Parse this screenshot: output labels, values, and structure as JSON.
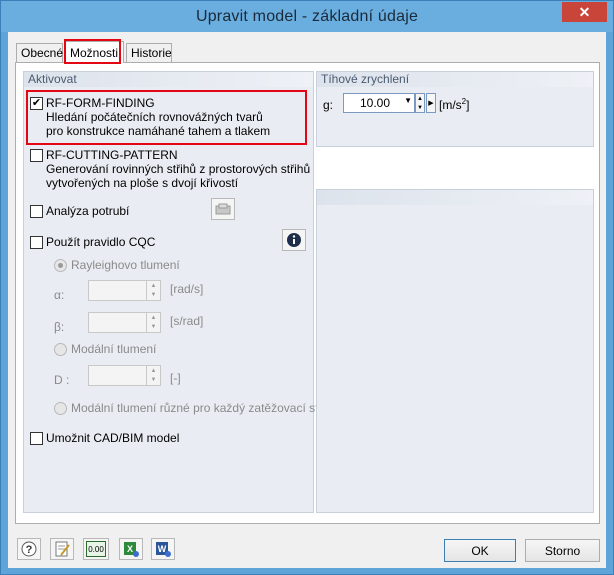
{
  "window": {
    "title": "Upravit model - základní údaje",
    "close_glyph": "✕"
  },
  "tabs": [
    {
      "label": "Obecné"
    },
    {
      "label": "Možnosti"
    },
    {
      "label": "Historie"
    }
  ],
  "activate": {
    "title": "Aktivovat",
    "form_finding": {
      "checked": true,
      "label": "RF-FORM-FINDING",
      "line2": "Hledání počátečních rovnovážných tvarů",
      "line3": "pro konstrukce namáhané tahem a tlakem"
    },
    "cutting_pattern": {
      "checked": false,
      "label": "RF-CUTTING-PATTERN",
      "line2": "Generování rovinných střihů z prostorových střihů",
      "line3": "vytvořených na ploše s dvojí křivostí"
    },
    "pipe_analysis": {
      "checked": false,
      "label": "Analýza potrubí"
    },
    "cqc": {
      "checked": false,
      "label": "Použít pravidlo CQC"
    },
    "rayleigh": {
      "label": "Rayleighovo tlumení"
    },
    "alpha": {
      "label": "α:",
      "unit": "[rad/s]"
    },
    "beta": {
      "label": "β:",
      "unit": "[s/rad]"
    },
    "modal": {
      "label": "Modální tlumení"
    },
    "d": {
      "label": "D :",
      "unit": "[-]"
    },
    "modal_diff": {
      "label": "Modální tlumení různé pro každý zatěžovací stav"
    },
    "cad_bim": {
      "checked": false,
      "label": "Umožnit CAD/BIM model"
    }
  },
  "gravity": {
    "title": "Tíhové zrychlení",
    "label": "g:",
    "value": "10.00",
    "unit": "[m/s",
    "unit_sup": "2",
    "unit_end": "]"
  },
  "footer": {
    "ok": "OK",
    "cancel": "Storno",
    "icon_value": "0.00"
  },
  "colors": {
    "title_bar": "#6aaee0",
    "highlight": "#e30613",
    "group_header": "#e9edf3"
  }
}
